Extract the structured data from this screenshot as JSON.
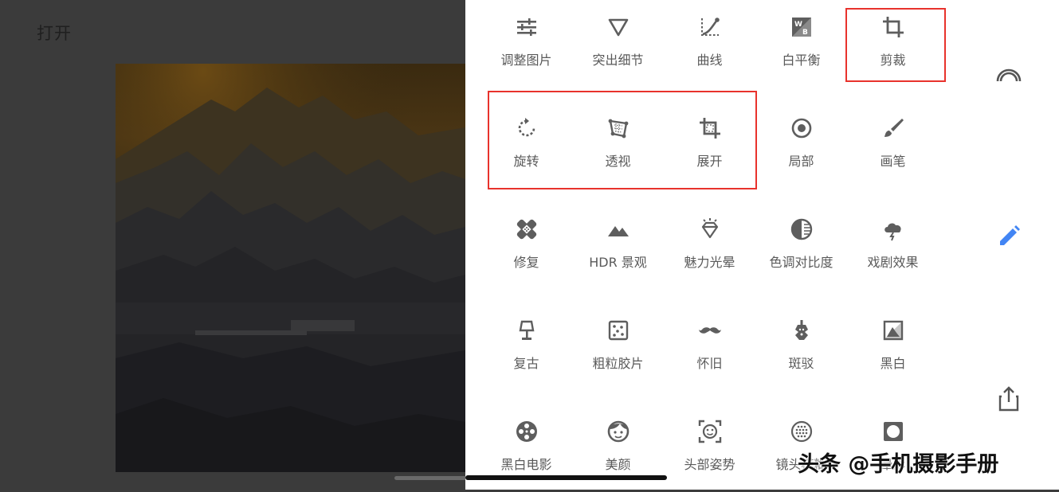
{
  "header": {
    "open_label": "打开"
  },
  "tools": [
    {
      "label": "调整图片",
      "icon": "tune-icon"
    },
    {
      "label": "突出细节",
      "icon": "triangle-down-icon"
    },
    {
      "label": "曲线",
      "icon": "curves-icon"
    },
    {
      "label": "白平衡",
      "icon": "white-balance-icon"
    },
    {
      "label": "剪裁",
      "icon": "crop-icon"
    },
    {
      "label": "旋转",
      "icon": "rotate-icon"
    },
    {
      "label": "透视",
      "icon": "perspective-icon"
    },
    {
      "label": "展开",
      "icon": "expand-icon"
    },
    {
      "label": "局部",
      "icon": "selective-icon"
    },
    {
      "label": "画笔",
      "icon": "brush-icon"
    },
    {
      "label": "修复",
      "icon": "healing-icon"
    },
    {
      "label": "HDR 景观",
      "icon": "mountains-icon"
    },
    {
      "label": "魅力光晕",
      "icon": "diamond-icon"
    },
    {
      "label": "色调对比度",
      "icon": "tonal-contrast-icon"
    },
    {
      "label": "戏剧效果",
      "icon": "cloud-storm-icon"
    },
    {
      "label": "复古",
      "icon": "lamp-icon"
    },
    {
      "label": "粗粒胶片",
      "icon": "grain-icon"
    },
    {
      "label": "怀旧",
      "icon": "mustache-icon"
    },
    {
      "label": "斑驳",
      "icon": "guitar-icon"
    },
    {
      "label": "黑白",
      "icon": "bw-icon"
    },
    {
      "label": "黑白电影",
      "icon": "film-reel-icon"
    },
    {
      "label": "美颜",
      "icon": "face-icon"
    },
    {
      "label": "头部姿势",
      "icon": "face-frame-icon"
    },
    {
      "label": "镜头模糊",
      "icon": "lens-blur-icon"
    },
    {
      "label": "晕影",
      "icon": "vignette-icon"
    }
  ],
  "rail": {
    "icons": [
      "styles-icon",
      "edit-pencil-icon",
      "share-icon"
    ],
    "accent": "#4285f4"
  },
  "watermark": "头条 @手机摄影手册",
  "highlight_color": "#e8322c"
}
